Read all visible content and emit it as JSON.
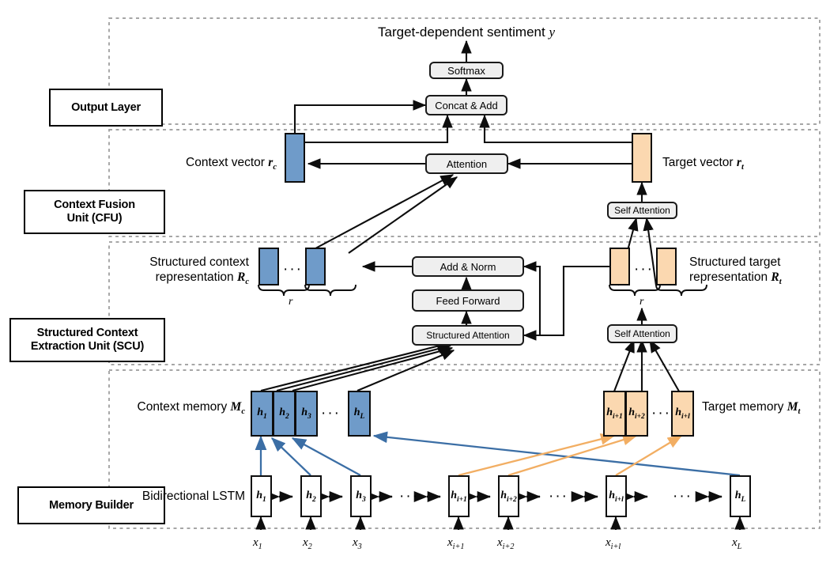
{
  "diagram": {
    "title_text": "Target-dependent  sentiment y",
    "title_plain": "Target-dependent sentiment",
    "title_var": "y"
  },
  "layer_labels": [
    {
      "id": "output-layer",
      "label": "Output Layer"
    },
    {
      "id": "context-fusion-unit",
      "label": "Context Fusion\nUnit (CFU)",
      "line1": "Context Fusion",
      "line2": "Unit (CFU)"
    },
    {
      "id": "structured-context-extraction-unit",
      "label": "Structured Context\nExtraction Unit (SCU)",
      "line1": "Structured Context",
      "line2": "Extraction Unit (SCU)"
    },
    {
      "id": "memory-builder",
      "label": "Memory Builder"
    }
  ],
  "blocks": {
    "softmax": "Softmax",
    "concat_add": "Concat & Add",
    "attention": "Attention",
    "self_attention_cfu": "Self Attention",
    "add_norm": "Add & Norm",
    "feed_forward": "Feed Forward",
    "structured_attention": "Structured Attention",
    "self_attention_scu": "Self Attention"
  },
  "annotations": {
    "context_vector": {
      "text": "Context vector",
      "var": "r",
      "sub": "c"
    },
    "target_vector": {
      "text": "Target vector",
      "var": "r",
      "sub": "t"
    },
    "structured_context": {
      "line1": "Structured context",
      "line2": "representation",
      "var": "R",
      "sub": "c"
    },
    "structured_target": {
      "line1": "Structured target",
      "line2": "representation",
      "var": "R",
      "sub": "t"
    },
    "context_memory": {
      "text": "Context memory",
      "var": "M",
      "sub": "c"
    },
    "target_memory": {
      "text": "Target memory",
      "var": "M",
      "sub": "t"
    },
    "bilstm": "Bidirectional LSTM",
    "brace_r_left": "r",
    "brace_r_right": "r",
    "ellipsis": "..."
  },
  "memory": {
    "context": [
      {
        "var": "h",
        "sub": "1"
      },
      {
        "var": "h",
        "sub": "2"
      },
      {
        "var": "h",
        "sub": "3"
      },
      {
        "var": "h",
        "sub": "L"
      }
    ],
    "target": [
      {
        "var": "h",
        "sub": "i+1"
      },
      {
        "var": "h",
        "sub": "i+2"
      },
      {
        "var": "h",
        "sub": "i+l"
      }
    ]
  },
  "lstm_cells": [
    {
      "var": "h",
      "sub": "1",
      "input": {
        "var": "x",
        "sub": "1"
      }
    },
    {
      "var": "h",
      "sub": "2",
      "input": {
        "var": "x",
        "sub": "2"
      }
    },
    {
      "var": "h",
      "sub": "3",
      "input": {
        "var": "x",
        "sub": "3"
      }
    },
    {
      "var": "h",
      "sub": "i+1",
      "input": {
        "var": "x",
        "sub": "i+1"
      }
    },
    {
      "var": "h",
      "sub": "i+2",
      "input": {
        "var": "x",
        "sub": "i+2"
      }
    },
    {
      "var": "h",
      "sub": "i+l",
      "input": {
        "var": "x",
        "sub": "i+l"
      }
    },
    {
      "var": "h",
      "sub": "L",
      "input": {
        "var": "x",
        "sub": "L"
      }
    }
  ],
  "colors": {
    "context_blue": "#6f9bc9",
    "target_orange": "#fbd8b0",
    "block_grey": "#efefef",
    "outline": "#0d0d0d",
    "boundary_dashed": "#9a9a9a",
    "blue_arrow": "#3b6ea5",
    "orange_arrow": "#f2ae63"
  }
}
